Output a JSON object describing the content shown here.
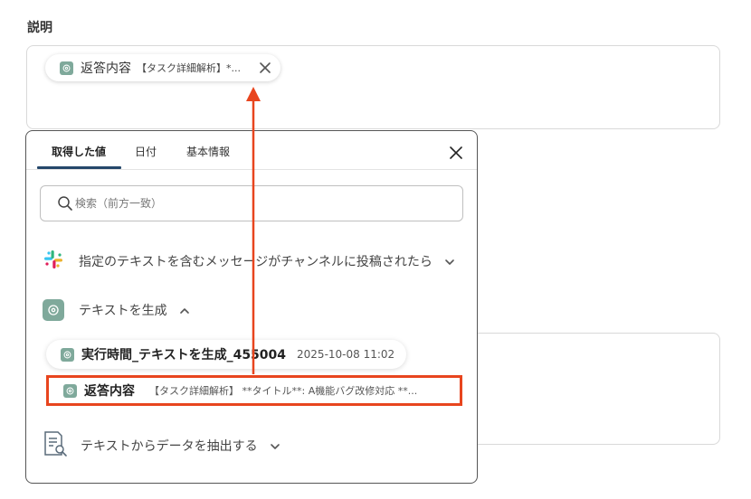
{
  "field": {
    "label": "説明"
  },
  "chip": {
    "title": "返答内容",
    "preview": "【タスク詳細解析】*..."
  },
  "panel": {
    "tabs": [
      {
        "label": "取得した値"
      },
      {
        "label": "日付"
      },
      {
        "label": "基本情報"
      }
    ],
    "search": {
      "placeholder": "検索（前方一致）",
      "value": ""
    },
    "sections": [
      {
        "title": "指定のテキストを含むメッセージがチャンネルに投稿されたら",
        "icon": "slack-icon",
        "expanded": false
      },
      {
        "title": "テキストを生成",
        "icon": "openai-icon",
        "expanded": true
      },
      {
        "title": "テキストからデータを抽出する",
        "icon": "document-search-icon",
        "expanded": false
      }
    ],
    "items": [
      {
        "title": "実行時間_テキストを生成_455004",
        "value": "2025-10-08 11:02"
      },
      {
        "title": "返答内容",
        "value": "【タスク詳細解析】 **タイトル**: A機能バグ改修対応 **..."
      }
    ]
  },
  "colors": {
    "highlight": "#e8451e",
    "accent": "#25476a",
    "openai_icon_bg": "#7fa99b"
  }
}
